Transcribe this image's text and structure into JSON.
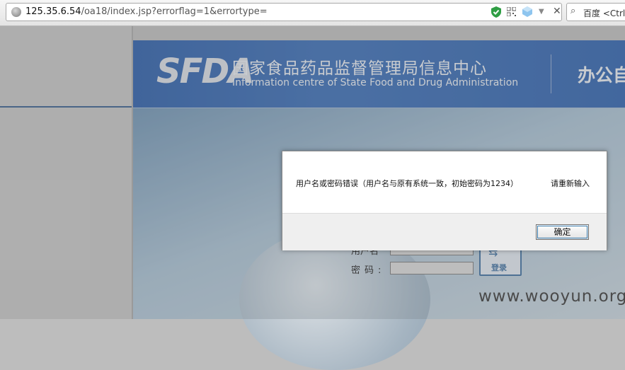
{
  "browser": {
    "url_host": "125.35.6.54",
    "url_path": "/oa18/index.jsp?errorflag=1&errortype=",
    "search_placeholder": "百度 <Ctrl+K>"
  },
  "banner": {
    "logo_text": "SFDA",
    "title_cn": "国家食品药品监督管理局信息中心",
    "title_en": "Information centre of State Food and Drug Administration",
    "right_text": "办公自"
  },
  "login": {
    "user_label": "用户名",
    "password_label": "密码:",
    "login_button": "登录"
  },
  "dialog": {
    "message": "用户名或密码错误（用户名与原有系统一致，初始密码为1234）",
    "message_tail": "请重新输入",
    "ok_label": "确定"
  },
  "watermark": "www.wooyun.org"
}
